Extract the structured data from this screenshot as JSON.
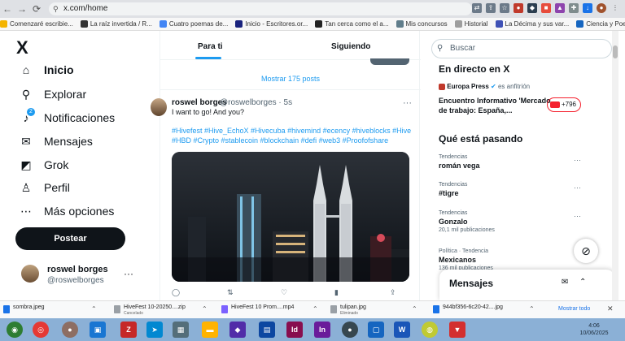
{
  "browser": {
    "url": "x.com/home",
    "bookmarks": [
      "Comenzaré escribie...",
      "La raíz invertida / R...",
      "Cuatro poemas de...",
      "Inicio - Escritores.or...",
      "Tan cerca como el a...",
      "Mis concursos",
      "Historial",
      "La Décima y sus var...",
      "Ciencia y Poesía de..."
    ]
  },
  "nav": {
    "logo": "X",
    "items": [
      {
        "label": "Inicio",
        "icon": "home-icon"
      },
      {
        "label": "Explorar",
        "icon": "search-icon"
      },
      {
        "label": "Notificaciones",
        "icon": "bell-icon",
        "badge": "2"
      },
      {
        "label": "Mensajes",
        "icon": "envelope-icon"
      },
      {
        "label": "Grok",
        "icon": "grok-icon"
      },
      {
        "label": "Perfil",
        "icon": "person-icon"
      },
      {
        "label": "Más opciones",
        "icon": "more-circle-icon"
      }
    ],
    "post_button": "Postear",
    "account": {
      "name": "roswel borges",
      "handle": "@roswelborges"
    }
  },
  "timeline": {
    "tabs": [
      "Para ti",
      "Siguiendo"
    ],
    "show_posts": "Mostrar 175 posts",
    "tweet": {
      "name": "roswel borges",
      "handle_time": "@roswelborges · 5s",
      "text": "I want to go! And you?",
      "hashtags": "#Hivefest #Hive_EchoX #Hivecuba #hivemind #ecency #hiveblocks #Hive #HBD #Crypto #stablecoin #blockchain #defi #web3 #Proofofshare"
    }
  },
  "right": {
    "search_placeholder": "Buscar",
    "live_heading": "En directo en X",
    "live_host": "Europa Press",
    "live_host_suffix": "es anfitrión",
    "live_title": "Encuentro Informativo 'Mercado de trabajo: España,...",
    "live_count": "+796",
    "trends_heading": "Qué está pasando",
    "trends": [
      {
        "category": "Tendencias",
        "name": "román vega",
        "count": ""
      },
      {
        "category": "Tendencias",
        "name": "#tigre",
        "count": ""
      },
      {
        "category": "Tendencias",
        "name": "Gonzalo",
        "count": "20,1 mil publicaciones"
      },
      {
        "category": "Política · Tendencia",
        "name": "Mexicanos",
        "count": "136 mil publicaciones"
      }
    ],
    "messages_title": "Mensajes"
  },
  "downloads": [
    {
      "name": "sombra.jpeg",
      "status": ""
    },
    {
      "name": "HiveFest 10-20250....zip",
      "status": "Cancelado"
    },
    {
      "name": "HiveFest 10 Prom....mp4",
      "status": ""
    },
    {
      "name": "tulipan.jpg",
      "status": "Eliminado"
    },
    {
      "name": "944bf356-6c20-42....jpg",
      "status": ""
    }
  ],
  "downloads_show_all": "Mostrar todo",
  "clock": {
    "time": "4:06",
    "date": "10/06/2025"
  }
}
